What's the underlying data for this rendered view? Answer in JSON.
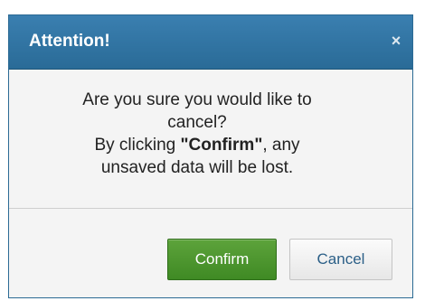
{
  "dialog": {
    "title": "Attention!",
    "close_glyph": "×",
    "message": {
      "line1": "Are you sure you would like to",
      "line2": "cancel?",
      "line3_prefix": "By clicking ",
      "line3_strong": "\"Confirm\"",
      "line3_suffix": ", any",
      "line4": "unsaved data will be lost."
    },
    "buttons": {
      "confirm_label": "Confirm",
      "cancel_label": "Cancel"
    }
  },
  "colors": {
    "titlebar": "#2a6b97",
    "confirm": "#4a952d",
    "cancel_text": "#2b5f87"
  },
  "icons": {
    "close": "close-icon"
  }
}
